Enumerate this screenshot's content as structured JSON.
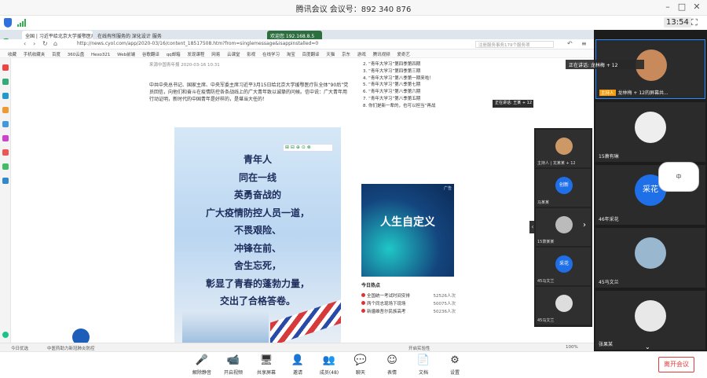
{
  "window": {
    "title": "腾讯会议 会议号：892 340 876"
  },
  "topbar": {
    "time": "13:54"
  },
  "browser": {
    "tabs": [
      "全国 | 习近平给北京大学援鄂医疗",
      "在线有所服务的 深化设计 服务",
      "欢迎您 192.168.8.5"
    ],
    "url": "http://news.cyol.com/app/2020-03/16/content_18517508.htm?from=singlemessage&isappinstalled=0",
    "search": "注册服务事务179个服务项",
    "bookmarks": [
      "收藏",
      "手机收藏夹",
      "百度",
      "360云盘",
      "Hexo321",
      "Web前端",
      "谷歌翻译",
      "qq邮箱",
      "发现课程",
      "网易",
      "云课堂",
      "影视",
      "在线学习",
      "淘宝",
      "百度翻译",
      "天猫",
      "京东",
      "游戏",
      "腾讯视频",
      "爱奇艺"
    ]
  },
  "article": {
    "date": "来源中国青年报 2020-03-16 10:31",
    "paragraph": "中共中央总书记、国家主席、中央军委主席习近平3月15日给北京大学援鄂医疗队全体“90后”党员回信，向他们和奋斗在疫情防控各条战线上的广大青年致以诚挚的问候。信中说：广大青年用行动证明，新时代的中国青年是好样的，是堪当大任的！",
    "poster_lines": [
      "青年人",
      "同在一线",
      "英勇奋战的",
      "广大疫情防控人员一道，",
      "不畏艰险、",
      "冲锋在前、",
      "舍生忘死，",
      "彰显了青春的蓬勃力量，",
      "交出了合格答卷。"
    ]
  },
  "rank": [
    "2. “青年大学习”第四季第四期",
    "3. “青年大学习”第四季第三期",
    "4. “青年大学习”第八季第一期来啦！",
    "5. “青年大学习”第八季第七期",
    "6. “青年大学习”第八季第六期",
    "7. “青年大学习”第八季第五期",
    "8. 你们是新一辈的，也可以担当“再战"
  ],
  "ad": {
    "title": "人生自定义",
    "tag": "广告"
  },
  "hot": {
    "heading": "今日热点",
    "items": [
      {
        "title": "全国统一考试时间安排",
        "count": "52526人次"
      },
      {
        "title": "两个同志现场下现场",
        "count": "50075人次"
      },
      {
        "title": "新疆维吾尔民族高考",
        "count": "50236人次"
      }
    ]
  },
  "strip": {
    "share_speaker": "正在讲话: 王某 + 12",
    "tiles": [
      {
        "name": "主持人 | 龙某某 + 12",
        "avatar": ""
      },
      {
        "name": "马某某",
        "avatar": "创新"
      },
      {
        "name": "15萧某某",
        "avatar": ""
      },
      {
        "name": "45马文兰",
        "avatar": ""
      },
      {
        "name": "46号某某",
        "avatar": "采花"
      },
      {
        "name": "45马文兰",
        "avatar": ""
      }
    ]
  },
  "videos": {
    "speaking": "正在讲话: 龙林梅 + 12",
    "tiles": [
      {
        "host": "主持人",
        "name": "龙林梅 + 12的屏幕共...",
        "avatar": ""
      },
      {
        "host": "",
        "name": "15萧有琳",
        "avatar": ""
      },
      {
        "host": "",
        "name": "46年采花",
        "avatar": "采花"
      },
      {
        "host": "",
        "name": "45马文兰",
        "avatar": ""
      },
      {
        "host": "",
        "name": "张果某",
        "avatar": ""
      }
    ],
    "sticker": "中"
  },
  "controls": [
    {
      "label": "解除静音",
      "icon": "🎤"
    },
    {
      "label": "开启视频",
      "icon": "📹"
    },
    {
      "label": "共享屏幕",
      "icon": "🖥"
    },
    {
      "label": "邀请",
      "icon": "👤"
    },
    {
      "label": "成员(48)",
      "icon": "👥"
    },
    {
      "label": "聊天",
      "icon": "💬"
    },
    {
      "label": "表情",
      "icon": "☺"
    },
    {
      "label": "文档",
      "icon": "📄"
    },
    {
      "label": "设置",
      "icon": "⚙"
    }
  ],
  "leave_label": "离开会议",
  "statusbar": [
    "今日优选",
    "中医药助力新冠肺炎防控",
    "开启实验性",
    "100%"
  ]
}
